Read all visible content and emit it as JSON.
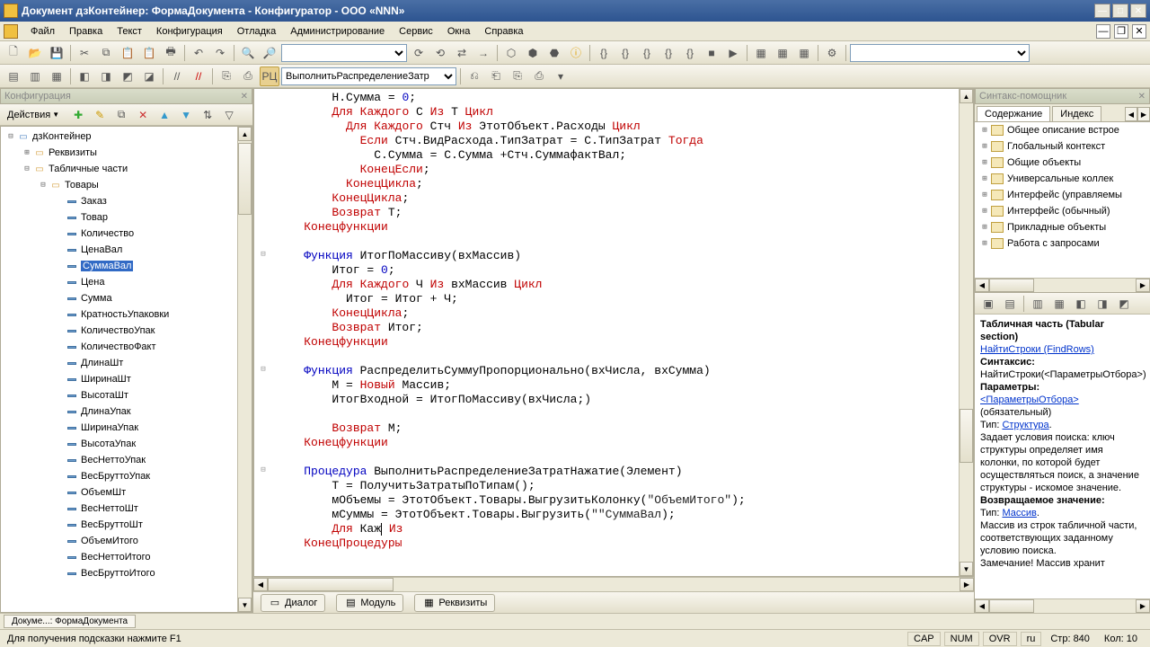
{
  "window": {
    "title": "Документ дзКонтейнер: ФормаДокумента - Конфигуратор - ООО «NNN»"
  },
  "menu": {
    "file": "Файл",
    "edit": "Правка",
    "text": "Текст",
    "config": "Конфигурация",
    "debug": "Отладка",
    "admin": "Администрирование",
    "service": "Сервис",
    "windows": "Окна",
    "help": "Справка"
  },
  "toolbar2": {
    "proc_label": "ВыполнитьРаспределениеЗатр"
  },
  "left": {
    "dock_title": "Конфигурация",
    "actions": "Действия",
    "tree": {
      "root": "дзКонтейнер",
      "rekvizity": "Реквизиты",
      "tabparts": "Табличные части",
      "tovary": "Товары",
      "items": [
        "Заказ",
        "Товар",
        "Количество",
        "ЦенаВал",
        "СуммаВал",
        "Цена",
        "Сумма",
        "КратностьУпаковки",
        "КоличествоУпак",
        "КоличествоФакт",
        "ДлинаШт",
        "ШиринаШт",
        "ВысотаШт",
        "ДлинаУпак",
        "ШиринаУпак",
        "ВысотаУпак",
        "ВесНеттоУпак",
        "ВесБруттоУпак",
        "ОбъемШт",
        "ВесНеттоШт",
        "ВесБруттоШт",
        "ОбъемИтого",
        "ВесНеттоИтого",
        "ВесБруттоИтого"
      ],
      "selected_index": 4
    }
  },
  "editor": {
    "code_html": "        Н.Сумма = <span class='kw-blue'>0</span>;\n        <span class='kw-red'>Для</span> <span class='kw-red'>Каждого</span> С <span class='kw-red'>Из</span> Т <span class='kw-red'>Цикл</span>\n          <span class='kw-red'>Для</span> <span class='kw-red'>Каждого</span> Стч <span class='kw-red'>Из</span> ЭтотОбъект.Расходы <span class='kw-red'>Цикл</span>\n            <span class='kw-red'>Если</span> Стч.ВидРасхода.ТипЗатрат = С.ТипЗатрат <span class='kw-red'>Тогда</span>\n              С.Сумма = С.Сумма +Стч.СуммафактВал;\n            <span class='kw-red'>КонецЕсли</span>;\n          <span class='kw-red'>КонецЦикла</span>;\n        <span class='kw-red'>КонецЦикла</span>;\n        <span class='kw-red'>Возврат</span> Т;\n    <span class='kw-red'>Конецфункции</span>\n\n    <span class='kw-blue'>Функция</span> ИтогПоМассиву(вхМассив)\n        Итог = <span class='kw-blue'>0</span>;\n        <span class='kw-red'>Для</span> <span class='kw-red'>Каждого</span> Ч <span class='kw-red'>Из</span> вхМассив <span class='kw-red'>Цикл</span>\n          Итог = Итог + Ч;\n        <span class='kw-red'>КонецЦикла</span>;\n        <span class='kw-red'>Возврат</span> Итог;\n    <span class='kw-red'>Конецфункции</span>\n\n    <span class='kw-blue'>Функция</span> РаспределитьСуммуПропорционально(вхЧисла, вхСумма)\n        М = <span class='kw-red'>Новый</span> Массив;\n        ИтогВходной = ИтогПоМассиву(вхЧисла;)\n\n        <span class='kw-red'>Возврат</span> М;\n    <span class='kw-red'>Конецфункции</span>\n\n    <span class='kw-blue'>Процедура</span> ВыполнитьРаспределениеЗатратНажатие(Элемент)\n        Т = ПолучитьЗатратыПоТипам();\n        мОбъемы = ЭтотОбъект.Товары.ВыгрузитьКолонку(<span class='str'>\"ОбъемИтого\"</span>);\n        мСуммы = ЭтотОбъект.Товары.Выгрузить(<span class='str'>\"\"СуммаВал</span>);\n        <span class='kw-red'>Для</span> Каж<span class='caret'></span> <span class='kw-red'>Из</span>\n    <span class='kw-red'>КонецПроцедуры</span>"
  },
  "bottom_tabs": {
    "dialog": "Диалог",
    "module": "Модуль",
    "rekv": "Реквизиты"
  },
  "right": {
    "dock_title": "Синтакс-помощник",
    "tab_content": "Содержание",
    "tab_index": "Индекс",
    "topics": [
      "Общее описание встрое",
      "Глобальный контекст",
      "Общие объекты",
      "Универсальные коллек",
      "Интерфейс (управляемы",
      "Интерфейс (обычный)",
      "Прикладные объекты",
      "Работа с запросами"
    ],
    "help": {
      "title": "Табличная часть (Tabular section)",
      "method": "НайтиСтроки (FindRows)",
      "syntax_label": "Синтаксис:",
      "syntax_body": "НайтиСтроки(<ПараметрыОтбора>)",
      "params_label": "Параметры:",
      "param_name": "<ПараметрыОтбора>",
      "param_req": "(обязательный)",
      "type_label": "Тип:",
      "type_link": "Структура",
      "desc": "Задает условия поиска: ключ структуры определяет имя колонки, по которой будет осуществляться поиск, а значение структуры - искомое значение.",
      "return_label": "Возвращаемое значение:",
      "return_type_label": "Тип:",
      "return_type_link": "Массив",
      "return_desc": "Массив из строк табличной части, соответствующих заданному условию поиска.",
      "note": "Замечание! Массив хранит"
    }
  },
  "wintab": "Докуме...: ФормаДокумента",
  "status": {
    "hint": "Для получения подсказки нажмите F1",
    "cap": "CAP",
    "num": "NUM",
    "ovr": "OVR",
    "lang": "ru",
    "line_label": "Стр:",
    "line": "840",
    "col_label": "Кол:",
    "col": "10"
  }
}
